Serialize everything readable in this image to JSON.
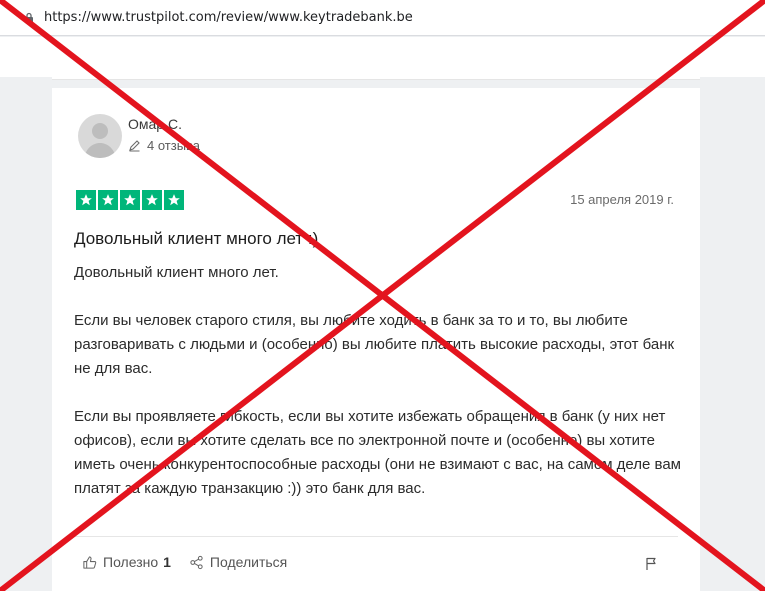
{
  "browser": {
    "url": "https://www.trustpilot.com/review/www.keytradebank.be"
  },
  "review": {
    "author": "Омар С.",
    "reviews_count": "4 отзыва",
    "rating": 5,
    "date": "15 апреля 2019 г.",
    "title": "Довольный клиент много лет :)",
    "paragraphs": [
      "Довольный клиент много лет.",
      "Если вы человек старого стиля, вы любите ходить в банк за то и то, вы любите разговаривать с людьми и (особенно) вы любите платить высокие расходы, этот банк не для вас.",
      "Если вы проявляете гибкость, если вы хотите избежать обращения в банк (у них нет офисов), если вы хотите сделать все по электронной почте и (особенно) вы хотите иметь очень конкурентоспособные расходы (они не взимают с вас, на самом деле вам платят за каждую транзакцию :)) это банк для вас."
    ],
    "actions": {
      "useful_label": "Полезно",
      "useful_count": "1",
      "share_label": "Поделиться"
    }
  },
  "colors": {
    "star_green": "#00b67a",
    "cross_red": "#e3141e"
  },
  "icons": [
    "lock-icon",
    "pencil-icon",
    "star-icon",
    "thumbs-up-icon",
    "share-icon",
    "flag-icon",
    "avatar-icon"
  ]
}
